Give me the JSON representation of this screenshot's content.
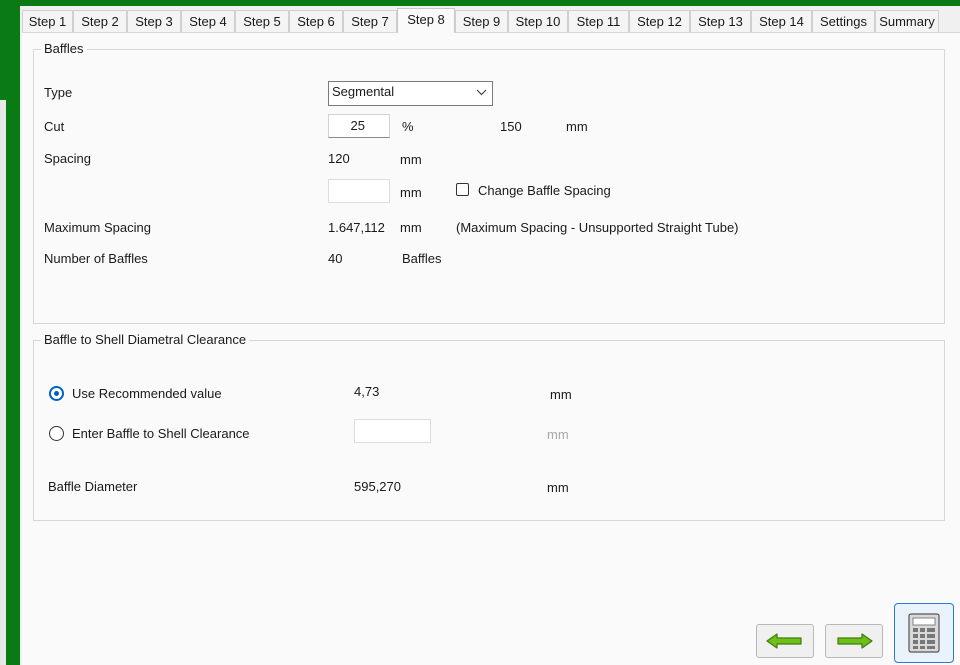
{
  "tabs": [
    {
      "label": "Step 1"
    },
    {
      "label": "Step 2"
    },
    {
      "label": "Step 3"
    },
    {
      "label": "Step 4"
    },
    {
      "label": "Step 5"
    },
    {
      "label": "Step 6"
    },
    {
      "label": "Step 7"
    },
    {
      "label": "Step 8"
    },
    {
      "label": "Step 9"
    },
    {
      "label": "Step 10"
    },
    {
      "label": "Step 11"
    },
    {
      "label": "Step 12"
    },
    {
      "label": "Step 13"
    },
    {
      "label": "Step 14"
    },
    {
      "label": "Settings"
    },
    {
      "label": "Summary"
    }
  ],
  "active_tab": "Step 8",
  "baffles": {
    "title": "Baffles",
    "type_label": "Type",
    "type_value": "Segmental",
    "cut_label": "Cut",
    "cut_value": "25",
    "cut_unit": "%",
    "cut_length": "150",
    "cut_length_unit": "mm",
    "spacing_label": "Spacing",
    "spacing_value": "120",
    "spacing_unit": "mm",
    "custom_spacing_value": "",
    "custom_spacing_unit": "mm",
    "change_spacing_label": "Change Baffle Spacing",
    "change_spacing_checked": false,
    "max_spacing_label": "Maximum Spacing",
    "max_spacing_value": "1.647,112",
    "max_spacing_unit": "mm",
    "max_spacing_note": "(Maximum Spacing - Unsupported Straight Tube)",
    "num_baffles_label": "Number of Baffles",
    "num_baffles_value": "40",
    "num_baffles_unit": "Baffles"
  },
  "clearance": {
    "title": "Baffle to Shell Diametral Clearance",
    "recommended_label": "Use Recommended value",
    "recommended_value": "4,73",
    "recommended_unit": "mm",
    "recommended_selected": true,
    "enter_label": "Enter Baffle to Shell Clearance",
    "enter_value": "",
    "enter_unit": "mm",
    "diameter_label": "Baffle Diameter",
    "diameter_value": "595,270",
    "diameter_unit": "mm"
  },
  "buttons": {
    "back_icon": "arrow-left-icon",
    "next_icon": "arrow-right-icon",
    "calculate_icon": "calculator-icon"
  },
  "colors": {
    "accent_green": "#0a7a14",
    "arrow_green": "#6fbf1a",
    "radio_blue": "#0061c2"
  }
}
